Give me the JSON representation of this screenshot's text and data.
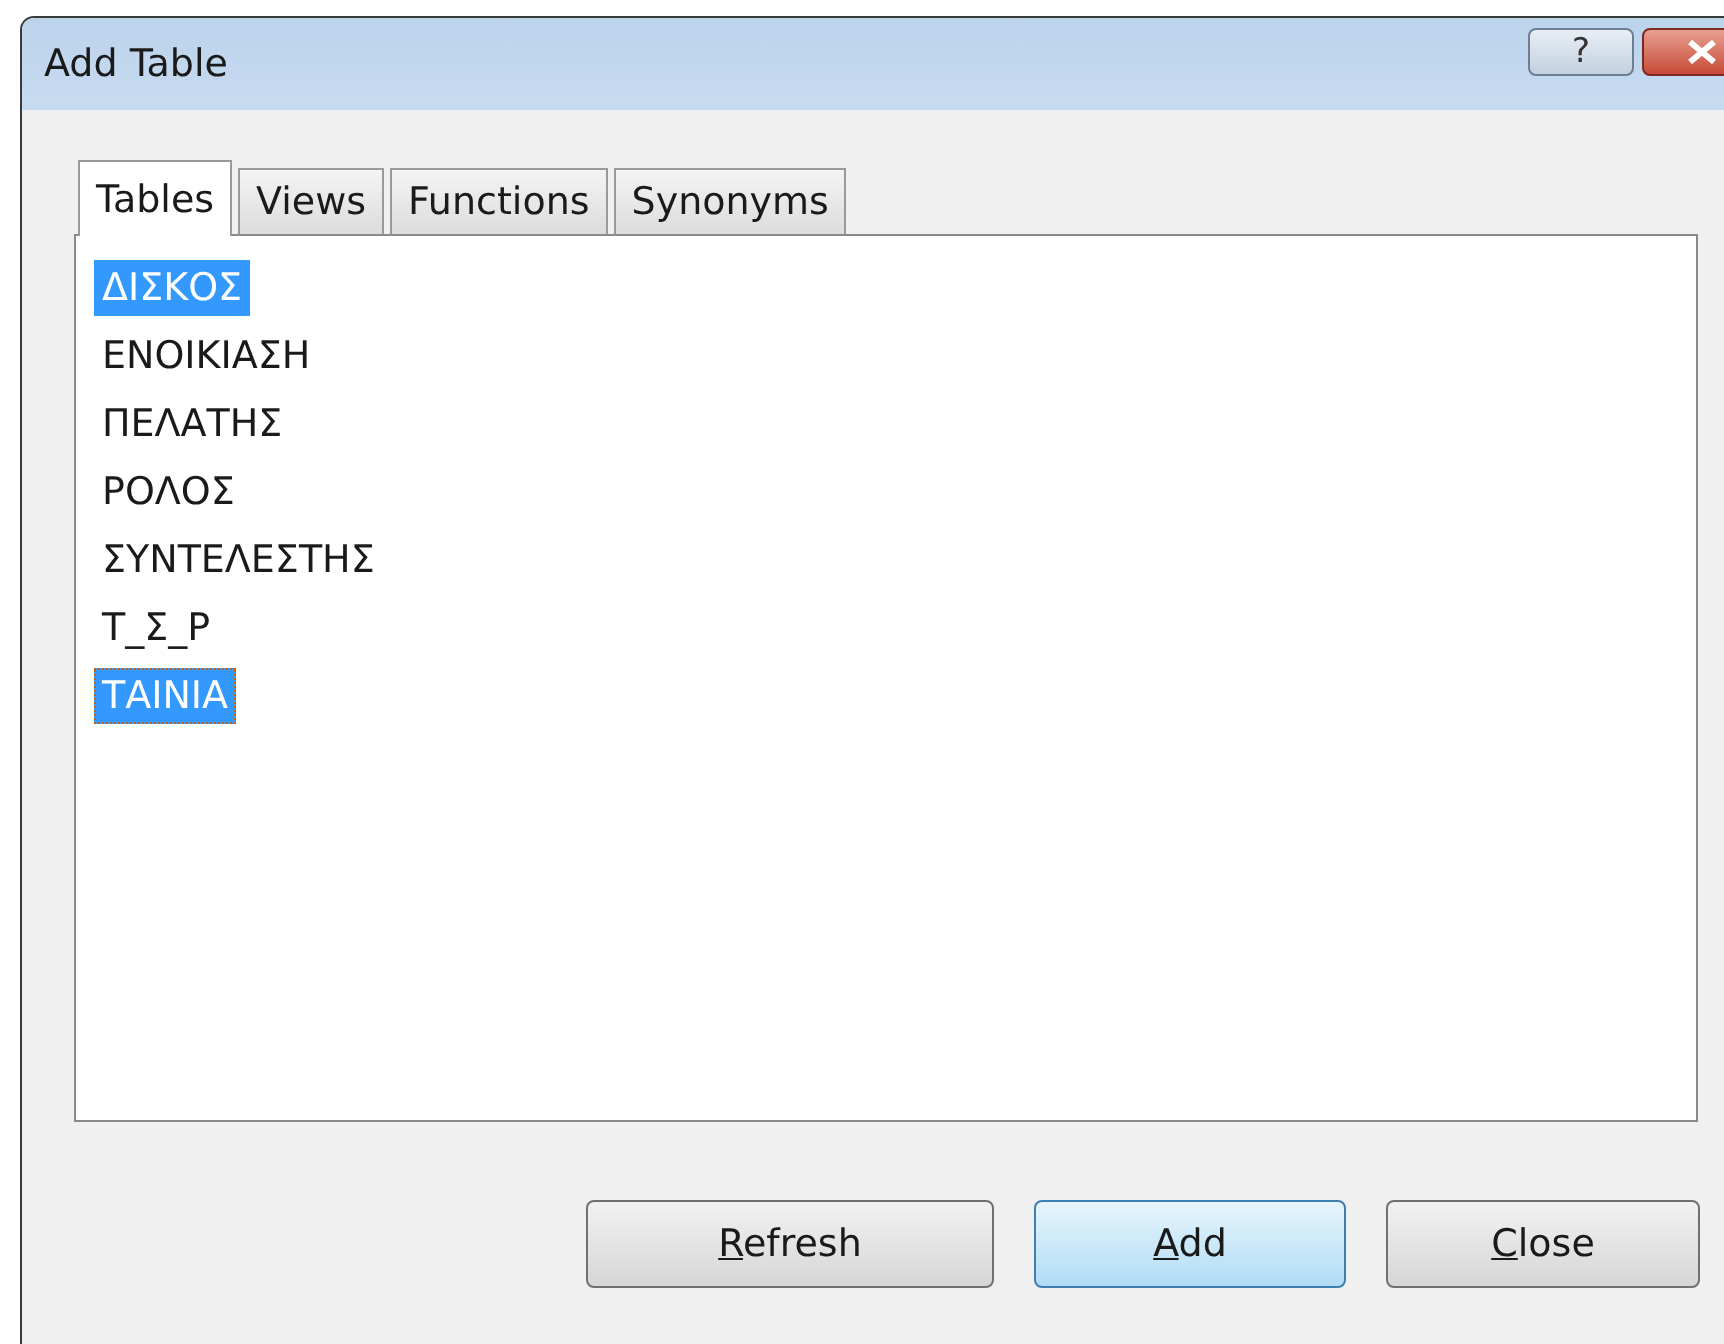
{
  "window": {
    "title": "Add Table",
    "help_button": "?"
  },
  "tabs": [
    {
      "label": "Tables",
      "selected": true
    },
    {
      "label": "Views",
      "selected": false
    },
    {
      "label": "Functions",
      "selected": false
    },
    {
      "label": "Synonyms",
      "selected": false
    }
  ],
  "list": {
    "items": [
      {
        "label": "ΔΙΣΚΟΣ",
        "selected": true,
        "focused": false
      },
      {
        "label": "ΕΝΟΙΚΙΑΣΗ",
        "selected": false,
        "focused": false
      },
      {
        "label": "ΠΕΛΑΤΗΣ",
        "selected": false,
        "focused": false
      },
      {
        "label": "ΡΟΛΟΣ",
        "selected": false,
        "focused": false
      },
      {
        "label": "ΣΥΝΤΕΛΕΣΤΗΣ",
        "selected": false,
        "focused": false
      },
      {
        "label": "Τ_Σ_Ρ",
        "selected": false,
        "focused": false
      },
      {
        "label": "ΤΑΙΝΙΑ",
        "selected": true,
        "focused": true
      }
    ]
  },
  "buttons": [
    {
      "label": "Refresh",
      "default": false
    },
    {
      "label": "Add",
      "default": true
    },
    {
      "label": "Close",
      "default": false
    }
  ]
}
